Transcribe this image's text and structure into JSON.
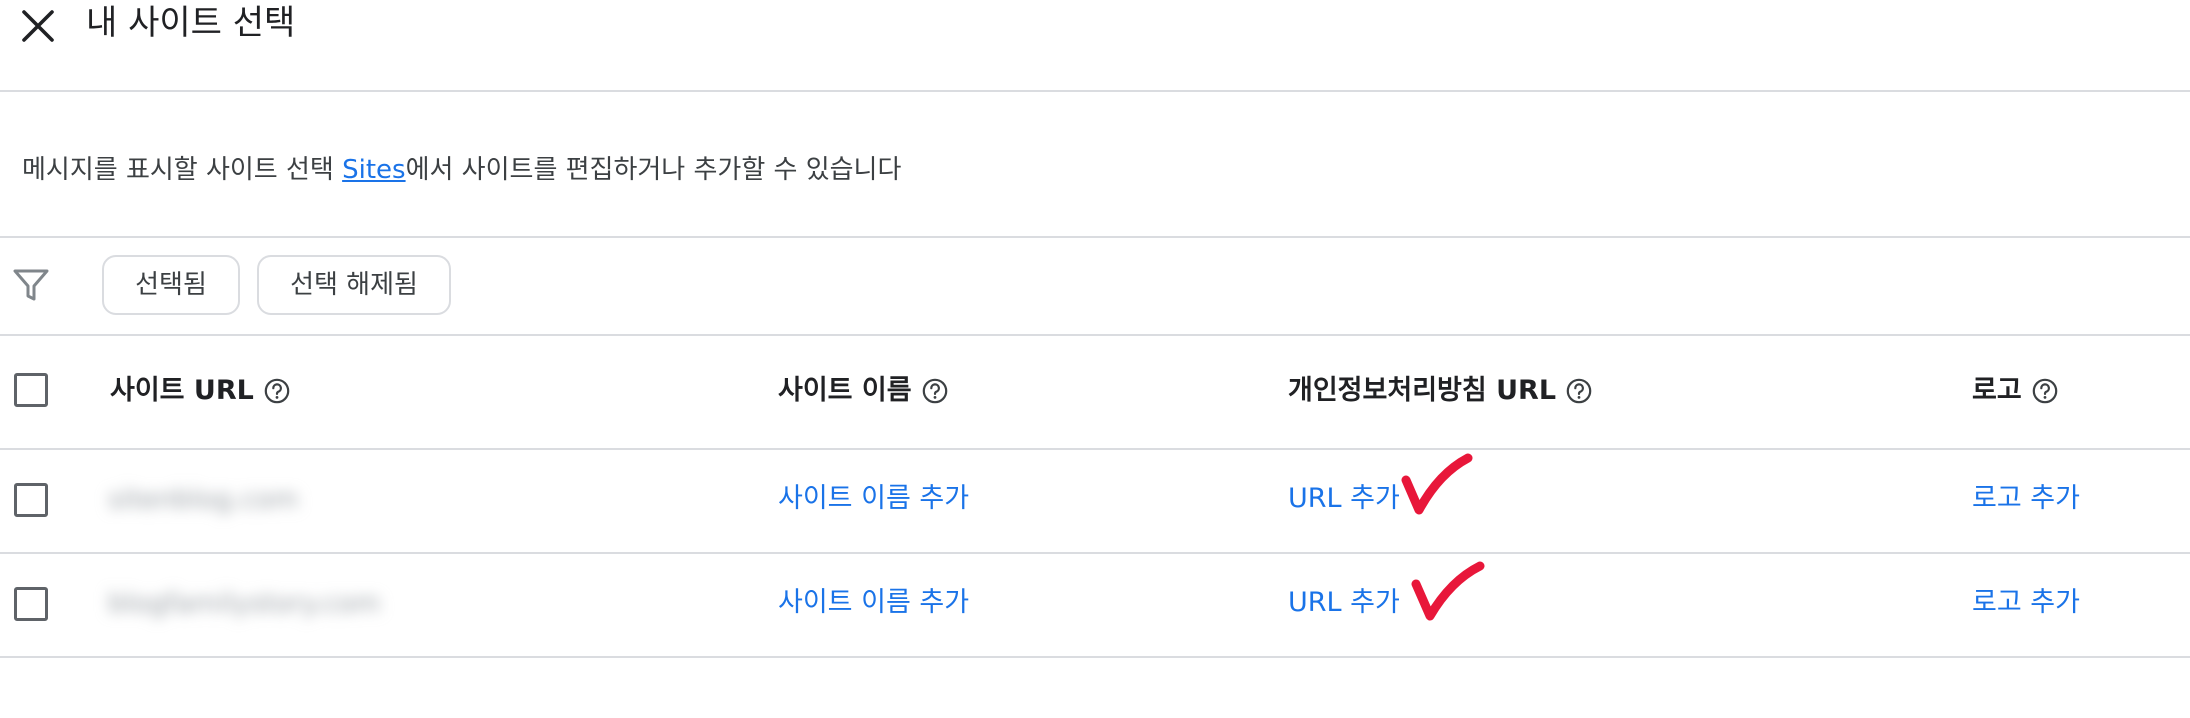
{
  "header": {
    "title": "내 사이트 선택",
    "close_icon": "close-icon"
  },
  "description": {
    "before": "메시지를 표시할 사이트 선택 ",
    "link": "Sites",
    "after": "에서 사이트를 편집하거나 추가할 수 있습니다"
  },
  "filter": {
    "icon": "filter-icon",
    "chips": [
      "선택됨",
      "선택 해제됨"
    ]
  },
  "table": {
    "columns": [
      "사이트 URL",
      "사이트 이름",
      "개인정보처리방침 URL",
      "로고"
    ],
    "rows": [
      {
        "site_url": "sitenblog.com",
        "site_name_action": "사이트 이름 추가",
        "privacy_url_action": "URL 추가",
        "logo_action": "로고 추가"
      },
      {
        "site_url": "blogfamilystory.com",
        "site_name_action": "사이트 이름 추가",
        "privacy_url_action": "URL 추가",
        "logo_action": "로고 추가"
      }
    ]
  },
  "colors": {
    "link": "#1a73e8",
    "divider": "#dadce0",
    "annotation_check": "#e8173a"
  }
}
